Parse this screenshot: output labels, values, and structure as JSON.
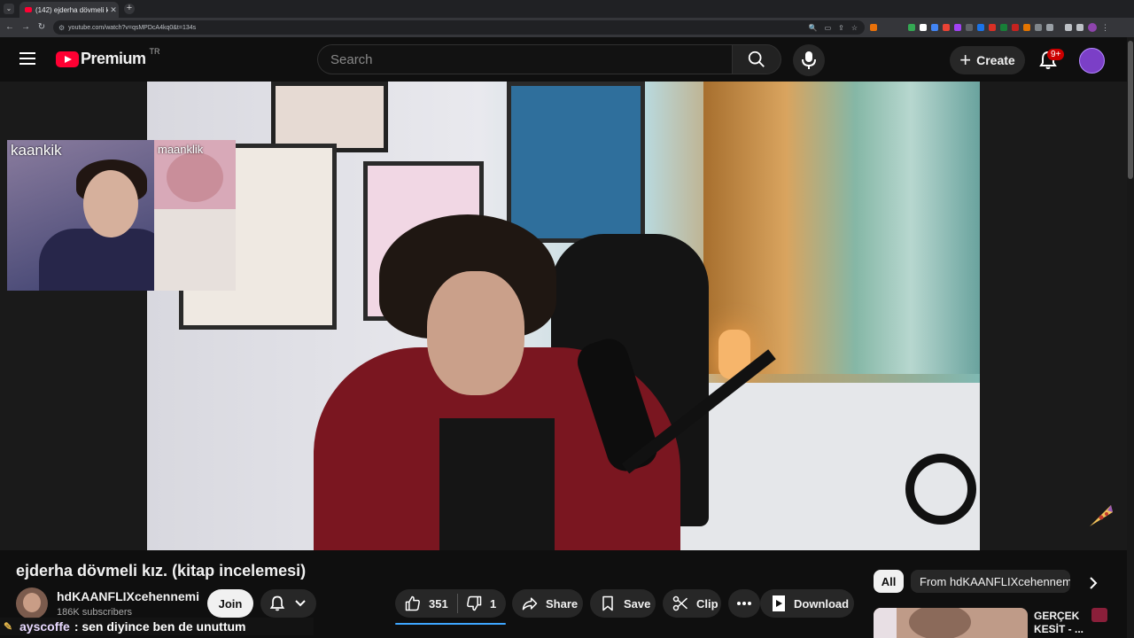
{
  "browser": {
    "tab_title": "(142) ejderha dövmeli kız. (kitap",
    "url": "youtube.com/watch?v=qsMPDcA4kq0&t=134s"
  },
  "header": {
    "brand": "Premium",
    "country_code": "TR",
    "search_placeholder": "Search",
    "create_label": "Create",
    "notifications_badge": "9+"
  },
  "player": {
    "pip_label_left": "kaankik",
    "pip_label_right": "maanklik"
  },
  "video": {
    "title": "ejderha dövmeli kız. (kitap incelemesi)",
    "channel_name": "hdKAANFLIXcehennemi",
    "subscribers": "186K subscribers",
    "join_label": "Join",
    "likes": "351",
    "dislikes": "1",
    "share_label": "Share",
    "save_label": "Save",
    "clip_label": "Clip",
    "download_label": "Download"
  },
  "chat": {
    "user": "ayscoffe",
    "message": ": sen diyince ben de unuttum"
  },
  "sidebar": {
    "chips": [
      "All",
      "From hdKAANFLIXcehennemi"
    ],
    "rec_title": "GERÇEK KESİT - ..."
  },
  "colors": {
    "background": "#0f0f0f",
    "brand_red": "#ff0033",
    "like_underline": "#3ea6ff",
    "badge_red": "#cc0000"
  }
}
